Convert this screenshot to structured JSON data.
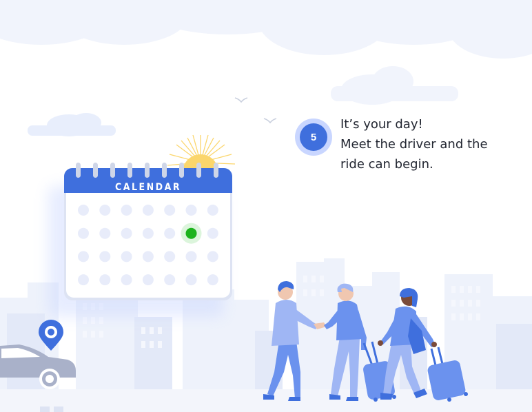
{
  "step": {
    "number": "5",
    "heading": "It’s your day!",
    "description": "Meet the driver and the ride can begin."
  },
  "calendar": {
    "title": "CALENDAR",
    "highlighted_day": {
      "row": 2,
      "col": 6
    }
  },
  "colors": {
    "accent": "#3f6fdd",
    "badge_ring": "#c9d6ff",
    "highlight": "#1db31d",
    "sun": "#fbd66c",
    "location_pin": "#3f6fdd"
  },
  "icons": {
    "location": "location-pin-icon",
    "sun": "sun-icon",
    "car": "car-icon"
  }
}
